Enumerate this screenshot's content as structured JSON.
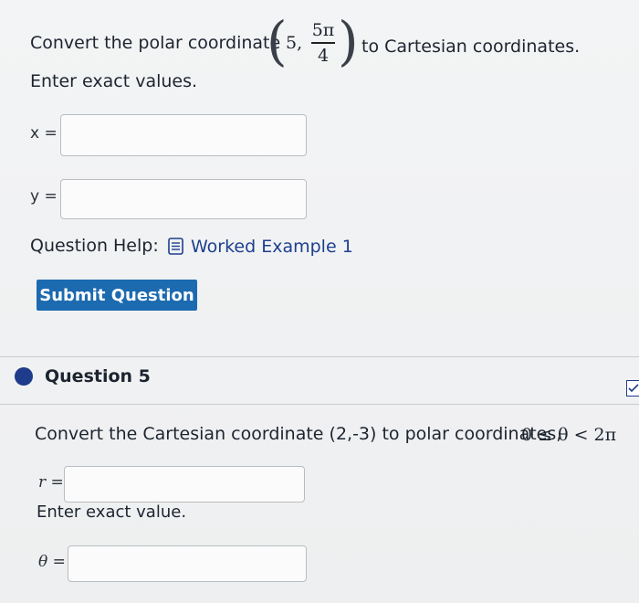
{
  "q4": {
    "prompt_before": "Convert the polar coordinate",
    "coord_r": "5,",
    "frac_num": "5π",
    "frac_den": "4",
    "prompt_after": "to Cartesian coordinates.",
    "instruction": "Enter exact values.",
    "x_label": "x =",
    "y_label": "y =",
    "x_value": "",
    "y_value": "",
    "help_label": "Question Help:",
    "worked_example": "Worked Example 1",
    "submit": "Submit Question"
  },
  "q5": {
    "title": "Question 5",
    "prompt": "Convert the Cartesian coordinate (2,-3) to polar coordinates,",
    "constraint": "0 ≤ θ < 2π",
    "r_label": "r =",
    "r_value": "",
    "r_hint": "Enter exact value.",
    "theta_label": "θ =",
    "theta_value": ""
  },
  "colors": {
    "accent": "#1c6ab0",
    "link": "#1d3f8f",
    "bullet": "#1f3b8c"
  }
}
